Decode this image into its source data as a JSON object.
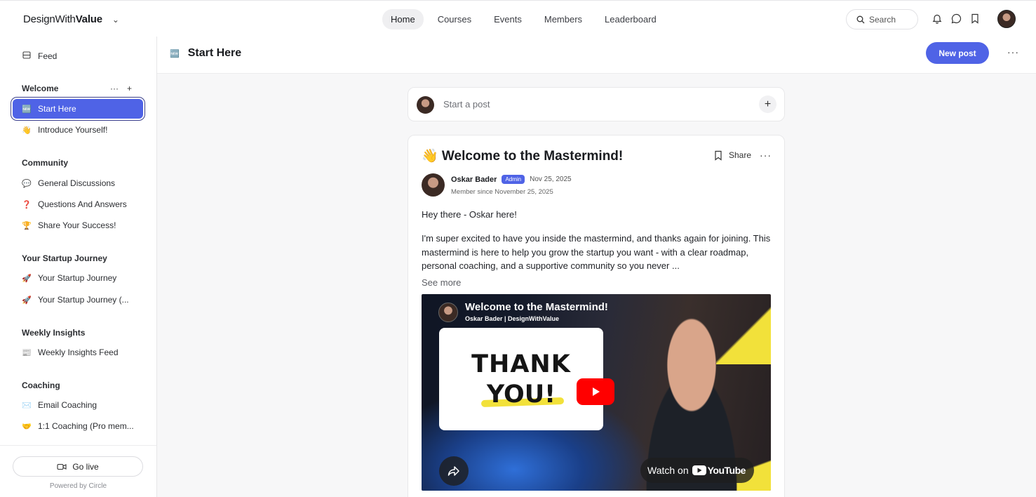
{
  "brand": {
    "name_regular": "DesignWith",
    "name_bold": "Value"
  },
  "nav": {
    "tabs": [
      {
        "label": "Home"
      },
      {
        "label": "Courses"
      },
      {
        "label": "Events"
      },
      {
        "label": "Members"
      },
      {
        "label": "Leaderboard"
      }
    ]
  },
  "search": {
    "placeholder": "Search"
  },
  "sidebar": {
    "feed": {
      "icon": "feed-icon",
      "label": "Feed"
    },
    "sections": [
      {
        "title": "Welcome",
        "items": [
          {
            "emoji": "🆕",
            "label": "Start Here",
            "active": true
          },
          {
            "emoji": "👋",
            "label": "Introduce Yourself!"
          }
        ]
      },
      {
        "title": "Community",
        "items": [
          {
            "emoji": "💬",
            "label": "General Discussions"
          },
          {
            "emoji": "❓",
            "label": "Questions And Answers"
          },
          {
            "emoji": "🏆",
            "label": "Share Your Success!"
          }
        ]
      },
      {
        "title": "Your Startup Journey",
        "items": [
          {
            "emoji": "🚀",
            "label": "Your Startup Journey"
          },
          {
            "emoji": "🚀",
            "label": "Your Startup Journey (..."
          }
        ]
      },
      {
        "title": "Weekly Insights",
        "items": [
          {
            "emoji": "📰",
            "label": "Weekly Insights Feed"
          }
        ]
      },
      {
        "title": "Coaching",
        "items": [
          {
            "emoji": "✉️",
            "label": "Email Coaching"
          },
          {
            "emoji": "🤝",
            "label": "1:1 Coaching (Pro mem..."
          }
        ]
      }
    ],
    "go_live": "Go live",
    "powered_by": "Powered by Circle"
  },
  "page": {
    "emoji": "🆕",
    "title": "Start Here",
    "new_post": "New post"
  },
  "composer": {
    "placeholder": "Start a post"
  },
  "post": {
    "title": "👋 Welcome to the Mastermind!",
    "share": "Share",
    "author": "Oskar Bader",
    "badge": "Admin",
    "date": "Nov 25, 2025",
    "member_since": "Member since November 25, 2025",
    "p1": "Hey there - Oskar here!",
    "p2": "I'm super excited to have you inside the mastermind, and thanks again for joining. This mastermind is here to help you grow the startup you want - with a clear roadmap, personal coaching, and a supportive community so you never ...",
    "see_more": "See more",
    "video": {
      "title": "Welcome to the Mastermind!",
      "channel": "Oskar Bader | DesignWithValue",
      "card_line1": "THANK",
      "card_line2": "YOU!",
      "watch_on": "Watch on",
      "youtube": "YouTube"
    }
  },
  "colors": {
    "accent": "#4f63e6",
    "youtube_red": "#ff0000",
    "highlight_yellow": "#f2e13a"
  }
}
